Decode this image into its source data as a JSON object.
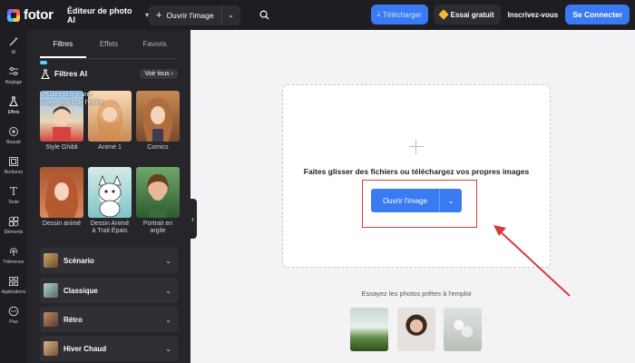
{
  "topbar": {
    "logo_text": "fotor",
    "editor_label": "Éditeur de photo AI",
    "open_image_label": "Ouvrir l'image",
    "download_label": "Télécharger",
    "trial_label": "Essai gratuit",
    "signup_label": "Inscrivez-vous",
    "login_label": "Se Connecter",
    "accent_color": "#3a7bf4"
  },
  "rail": {
    "items": [
      {
        "label": "AI",
        "icon": "magic-wand-icon"
      },
      {
        "label": "Réglage",
        "icon": "sliders-icon"
      },
      {
        "label": "Effets",
        "icon": "flask-icon"
      },
      {
        "label": "Beauté",
        "icon": "eye-icon"
      },
      {
        "label": "Bordures",
        "icon": "frame-icon"
      },
      {
        "label": "Texte",
        "icon": "text-icon"
      },
      {
        "label": "Éléments",
        "icon": "elements-icon"
      },
      {
        "label": "Téléverser",
        "icon": "upload-icon"
      },
      {
        "label": "Applications",
        "icon": "apps-icon"
      },
      {
        "label": "Plus",
        "icon": "more-icon"
      }
    ]
  },
  "panel": {
    "tabs": [
      "Filtres",
      "Effets",
      "Favoris"
    ],
    "ai_title": "Filtres AI",
    "see_all": "Voir tous",
    "tooltip": "Veuillez ouvrir une image avant de l'éditer",
    "cards": [
      {
        "label": "Style Ghibli"
      },
      {
        "label": "Animé 1"
      },
      {
        "label": "Comics"
      },
      {
        "label": "Dessin animé"
      },
      {
        "label": "Dessin Animé à Trait Épais"
      },
      {
        "label": "Portrait en argile"
      }
    ],
    "categories": [
      {
        "label": "Scénario"
      },
      {
        "label": "Classique"
      },
      {
        "label": "Rétro"
      },
      {
        "label": "Hiver Chaud"
      }
    ]
  },
  "main": {
    "drop_text": "Faites glisser des fichiers ou téléchargez vos propres images",
    "open_button": "Ouvrir l'image",
    "sample_title": "Essayez les photos prêtes à l'emploi",
    "highlight_color": "#d93b3b"
  }
}
